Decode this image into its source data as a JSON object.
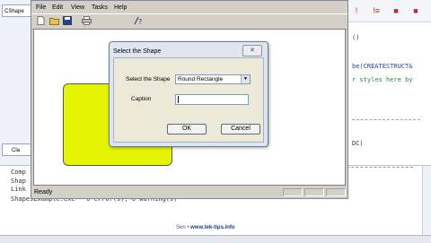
{
  "ide": {
    "tab_label": "CShape",
    "tab2_label": "Cla",
    "code_lines": [
      "()",
      "be(CREATESTRUCT&",
      "r styles here by",
      "DC)"
    ],
    "output_lines": [
      "Comp",
      "Shap",
      "Link",
      "ShapesExample.exe - 0 error(s), 0 warning(s)"
    ],
    "watermark_prefix": "Sen",
    "watermark_site": "www.tek-tips.info",
    "toolbar_icons": [
      "exclamation-icon",
      "bang-list-icon",
      "stop-icon",
      "stop-list-icon"
    ]
  },
  "app": {
    "menu": [
      "File",
      "Edit",
      "View",
      "Tasks",
      "Help"
    ],
    "toolbar_icons": [
      "new-file-icon",
      "open-folder-icon",
      "save-icon",
      "print-icon",
      "help-icon"
    ],
    "status_text": "Ready",
    "shape_color": "#e5f400"
  },
  "dialog": {
    "title": "Select the Shape",
    "close_symbol": "✕",
    "select_label": "Select the Shape",
    "select_value": "Round Rectangle",
    "caption_label": "Caption",
    "caption_value": "",
    "ok_label": "OK",
    "cancel_label": "Cancel"
  }
}
